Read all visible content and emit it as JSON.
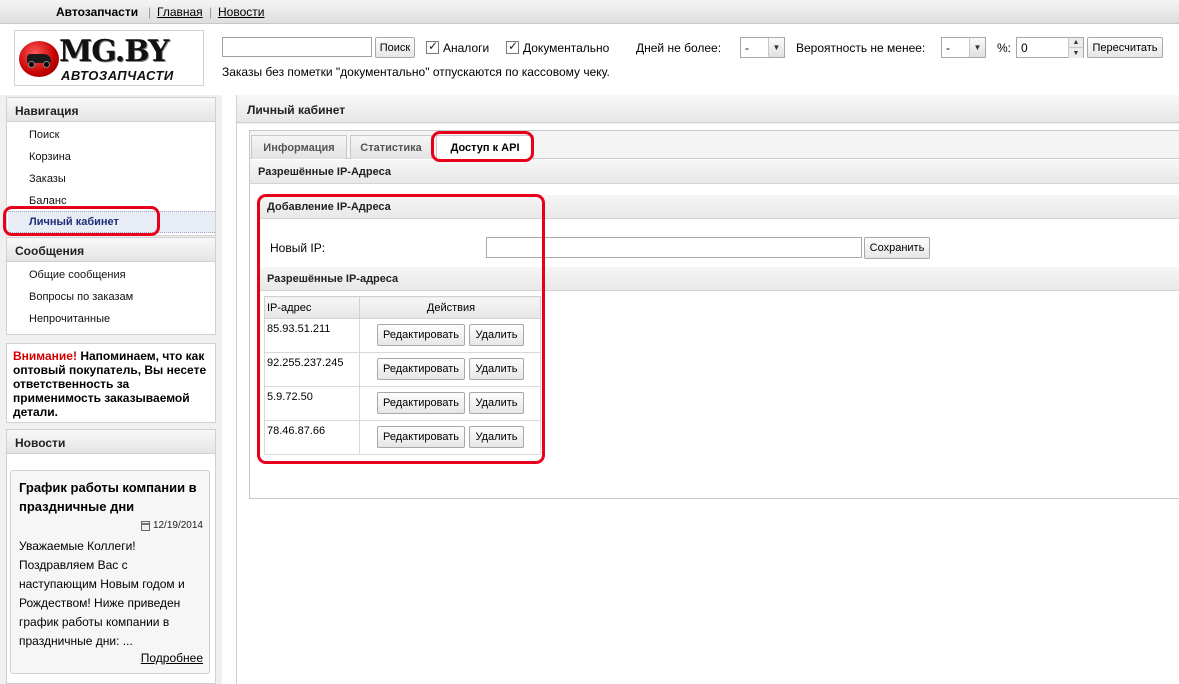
{
  "topnav": {
    "brand": "Автозапчасти",
    "links": [
      "Главная",
      "Новости"
    ]
  },
  "logo": {
    "title": "MG.BY",
    "subtitle": "АВТОЗАПЧАСТИ"
  },
  "search": {
    "input_value": "",
    "button": "Поиск",
    "analogs": {
      "label": "Аналоги",
      "checked": true
    },
    "documental": {
      "label": "Документально",
      "checked": true
    },
    "days_label": "Дней не более:",
    "days_value": "-",
    "probability_label": "Вероятность не менее:",
    "probability_value": "-",
    "percent_label": "%:",
    "percent_value": "0",
    "recalc_button": "Пересчитать",
    "note": "Заказы без пометки \"документально\" отпускаются по кассовому чеку."
  },
  "sidebar": {
    "nav_title": "Навигация",
    "nav_items": [
      "Поиск",
      "Корзина",
      "Заказы",
      "Баланс",
      "Личный кабинет"
    ],
    "messages_title": "Сообщения",
    "message_items": [
      "Общие сообщения",
      "Вопросы по заказам",
      "Непрочитанные"
    ],
    "warning_prefix": "Внимание!",
    "warning_text": "Напоминаем, что как оптовый покупатель, Вы несете ответственность за применимость заказываемой детали.",
    "news_title": "Новости",
    "news": {
      "headline": "График работы компании в праздничные дни",
      "date": "12/19/2014",
      "body": "Уважаемые Коллеги! Поздравляем Вас с наступающим Новым годом и Рождеством! Ниже приведен график работы компании в праздничные дни: ...",
      "more": "Подробнее"
    }
  },
  "main": {
    "title": "Личный кабинет",
    "tabs": [
      "Информация",
      "Статистика",
      "Доступ к API"
    ],
    "section_title": "Разрешённые IP-Адреса",
    "add_title": "Добавление IP-Адреса",
    "new_ip_label": "Новый IP:",
    "new_ip_value": "",
    "save_button": "Сохранить",
    "list_title": "Разрешённые IP-адреса",
    "columns": [
      "IP-адрес",
      "Действия"
    ],
    "rows": [
      {
        "ip": "85.93.51.211"
      },
      {
        "ip": "92.255.237.245"
      },
      {
        "ip": "5.9.72.50"
      },
      {
        "ip": "78.46.87.66"
      }
    ],
    "edit_label": "Редактировать",
    "delete_label": "Удалить"
  },
  "colors": {
    "annotation": "#e8001a",
    "active_nav": "#1f2f77",
    "warning": "#d40000"
  }
}
